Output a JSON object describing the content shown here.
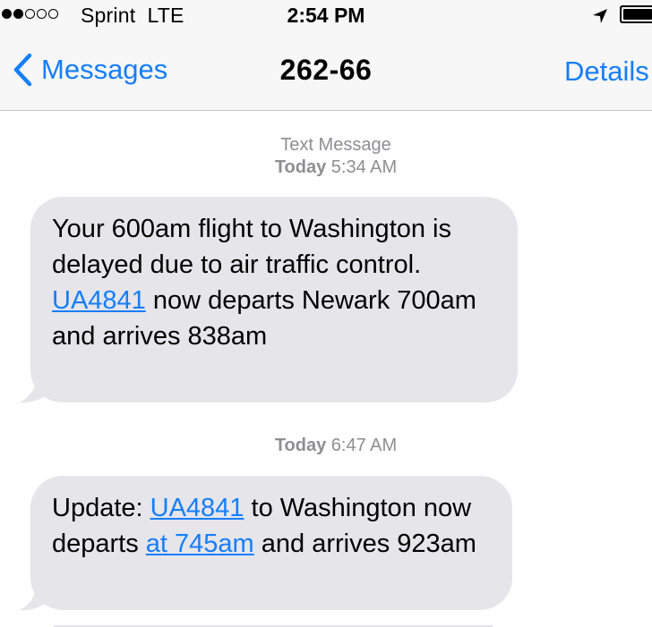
{
  "status_bar": {
    "carrier": "Sprint",
    "network": "LTE",
    "time": "2:54 PM",
    "icons": [
      "signal-dots",
      "location-arrow-icon",
      "battery-icon"
    ]
  },
  "nav": {
    "back_label": "Messages",
    "title": "262-66",
    "details_label": "Details"
  },
  "conversation": {
    "header_label": "Text Message",
    "messages": [
      {
        "day": "Today",
        "time": "5:34 AM",
        "segments": [
          {
            "text": "Your 600am flight to Washington is delayed due to air traffic control. ",
            "link": false
          },
          {
            "text": "UA4841",
            "link": true
          },
          {
            "text": " now departs Newark 700am and arrives 838am",
            "link": false
          }
        ]
      },
      {
        "day": "Today",
        "time": "6:47 AM",
        "segments": [
          {
            "text": "Update: ",
            "link": false
          },
          {
            "text": "UA4841",
            "link": true
          },
          {
            "text": " to Washington now departs ",
            "link": false
          },
          {
            "text": "at 745am",
            "link": true
          },
          {
            "text": " and arrives 923am",
            "link": false
          }
        ]
      }
    ]
  },
  "colors": {
    "accent": "#157efb",
    "bubble": "#e5e5ea",
    "meta_text": "#8e8e93",
    "bar_bg": "#f7f7f7"
  }
}
